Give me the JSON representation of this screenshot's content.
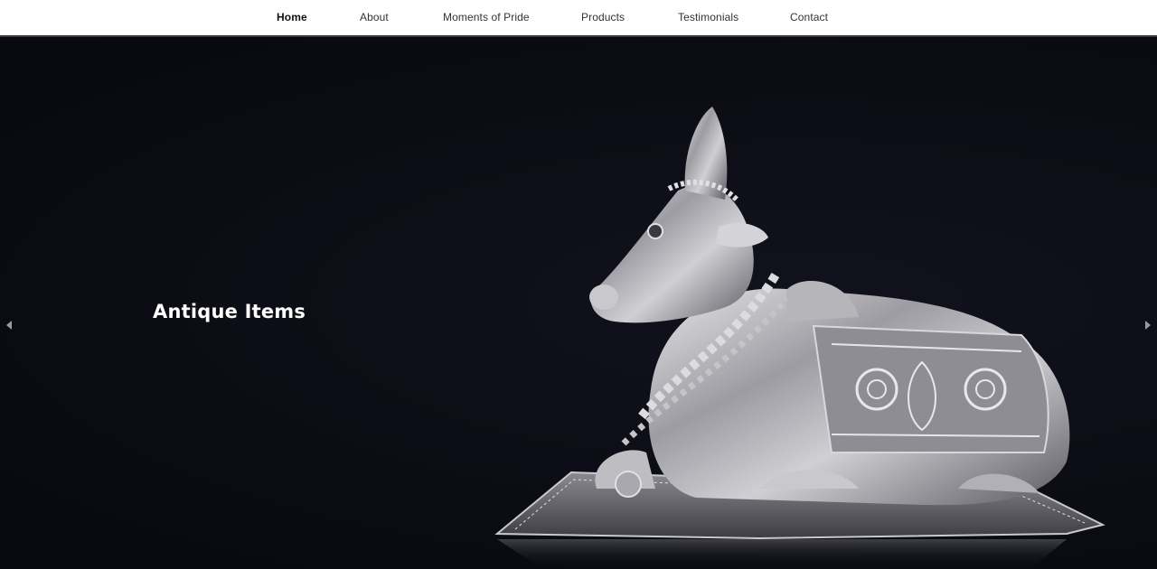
{
  "nav": {
    "items": [
      {
        "label": "Home",
        "active": true
      },
      {
        "label": "About",
        "active": false
      },
      {
        "label": "Moments of Pride",
        "active": false
      },
      {
        "label": "Products",
        "active": false
      },
      {
        "label": "Testimonials",
        "active": false
      },
      {
        "label": "Contact",
        "active": false
      }
    ]
  },
  "hero": {
    "caption": "Antique Items",
    "image_subject": "silver-nandi-bull-statue",
    "background_color": "#0b0c14",
    "prev_icon": "caret-left-icon",
    "next_icon": "caret-right-icon"
  },
  "colors": {
    "nav_background": "#ffffff",
    "nav_text": "#333333",
    "caption_text": "#ffffff",
    "silver": "#b9b9bd"
  }
}
